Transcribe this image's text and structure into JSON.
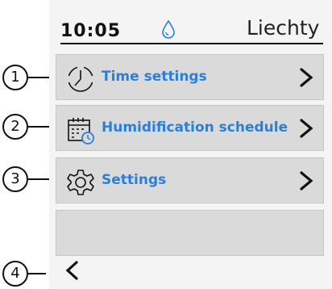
{
  "status": {
    "time": "10:05",
    "brand": "Liechty"
  },
  "menu": {
    "items": [
      {
        "label": "Time settings",
        "icon": "clock-icon"
      },
      {
        "label": "Humidification schedule",
        "icon": "calendar-clock-icon"
      },
      {
        "label": "Settings",
        "icon": "gear-icon"
      }
    ]
  },
  "nav": {
    "back_icon": "chevron-left-icon",
    "forward_icon": "chevron-right-icon"
  },
  "callouts": [
    "1",
    "2",
    "3",
    "4"
  ],
  "colors": {
    "label": "#2a7fd8",
    "row_bg": "#dadada",
    "screen_bg": "#f4f4f4"
  }
}
